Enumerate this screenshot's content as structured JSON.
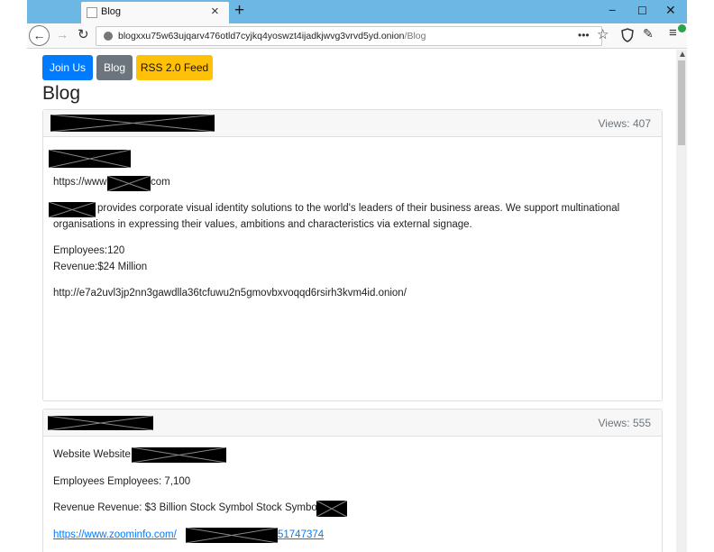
{
  "browser": {
    "tab_title": "Blog",
    "tab_close": "×",
    "new_tab": "+",
    "window_buttons": [
      "−",
      "☐",
      "✕"
    ],
    "url_host": "blogxxu75w63ujqarv476otld7cyjkq4yoswzt4ijadkjwvg3vrvd5yd.onion",
    "url_path": "/Blog",
    "url_more": "•••",
    "icons": [
      "back-arrow-icon",
      "forward-arrow-icon",
      "reload-icon",
      "star-icon",
      "shield-icon",
      "broom-icon",
      "menu-icon"
    ]
  },
  "nav": {
    "join_label": "Join Us",
    "blog_label": "Blog",
    "rss_label": "RSS 2.0 Feed"
  },
  "page_title": "Blog",
  "posts": [
    {
      "views": "Views: 407",
      "url_prefix": "https://www",
      "url_suffix": "com",
      "description": "provides corporate visual identity solutions to the world's leaders of their business areas. We support multinational",
      "description_cont": "organisations in expressing their values, ambitions and characteristics via external signage.",
      "employees": "Employees:120",
      "revenue": "Revenue:$24 Million",
      "onion_link": "http://e7a2uvl3jp2nn3gawdlla36tcfuwu2n5gmovbxvoqqd6rsirh3kvm4id.onion/"
    },
    {
      "views": "Views: 555",
      "website": "Website Website",
      "employees": "Employees Employees: 7,100",
      "revenue": "Revenue Revenue: $3 Billion Stock Symbol Stock Symbol:",
      "link_prefix": "https://www.zoominfo.com/",
      "link_suffix": "51747374"
    }
  ],
  "colors": {
    "titlebar": "#6cb7e3",
    "join_button": "#007bff",
    "blog_button": "#6c757d",
    "rss_button": "#ffc107"
  }
}
